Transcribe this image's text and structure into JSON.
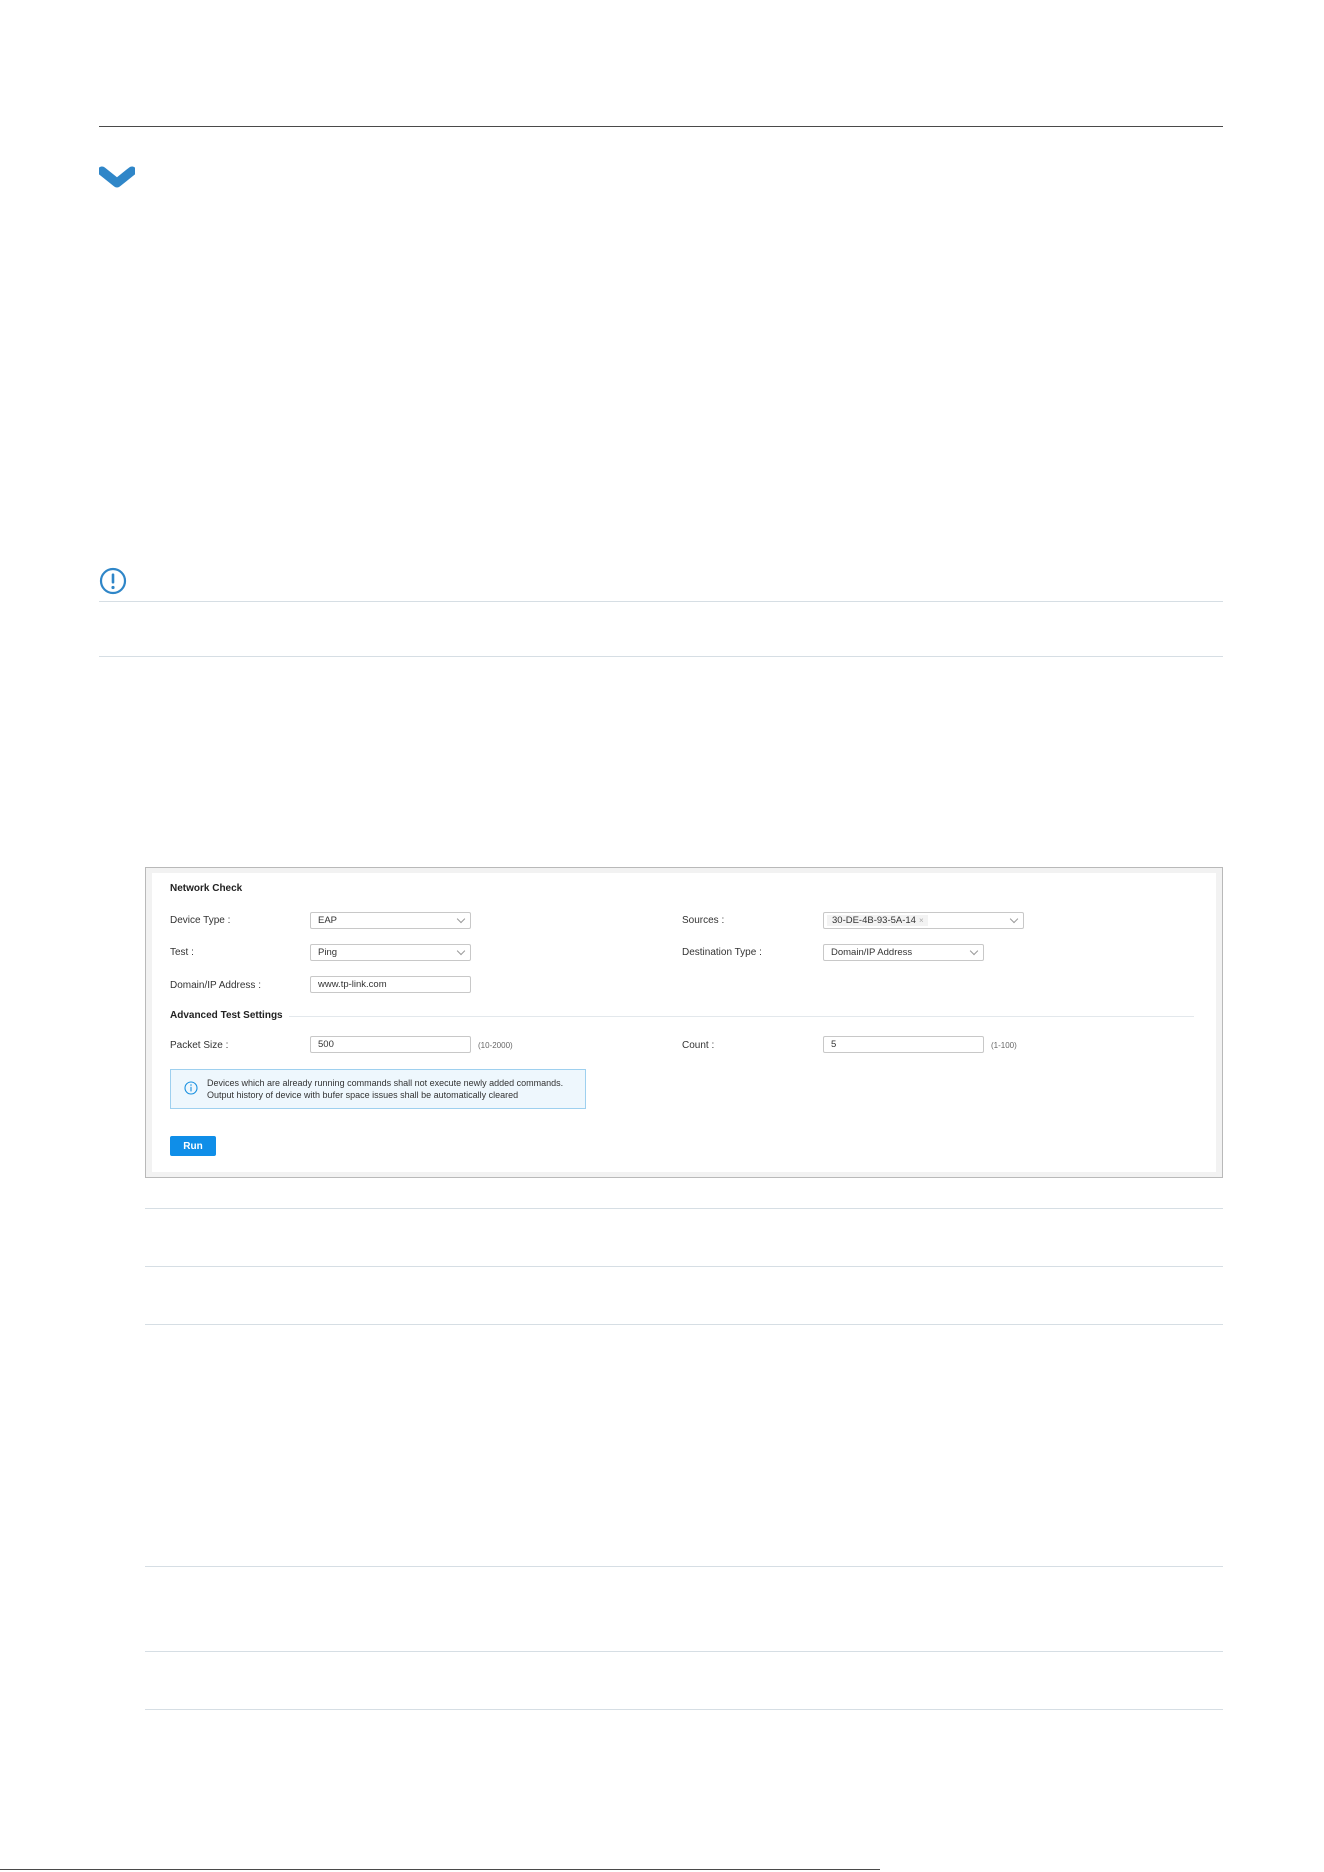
{
  "network_check": {
    "title": "Network Check",
    "device_type": {
      "label": "Device Type :",
      "value": "EAP"
    },
    "test": {
      "label": "Test :",
      "value": "Ping"
    },
    "domain_ip": {
      "label": "Domain/IP Address :",
      "value": "www.tp-link.com"
    },
    "sources": {
      "label": "Sources :",
      "tag": "30-DE-4B-93-5A-14",
      "tag_close": "×"
    },
    "destination_type": {
      "label": "Destination Type :",
      "value": "Domain/IP Address"
    },
    "advanced": {
      "title": "Advanced Test Settings",
      "packet_size": {
        "label": "Packet Size :",
        "value": "500",
        "range": "(10-2000)"
      },
      "count": {
        "label": "Count :",
        "value": "5",
        "range": "(1-100)"
      }
    },
    "notice": {
      "line1": "Devices which are already running commands shall not execute newly added commands.",
      "line2": "Output history of device with bufer space issues shall be automatically cleared"
    },
    "run_label": "Run"
  },
  "colors": {
    "accent": "#0f8ee8",
    "icon_blue": "#2f86c8",
    "info_border": "#9ed0ef"
  },
  "icons": [
    "chevron-down-icon",
    "exclamation-circle-icon",
    "info-icon"
  ]
}
